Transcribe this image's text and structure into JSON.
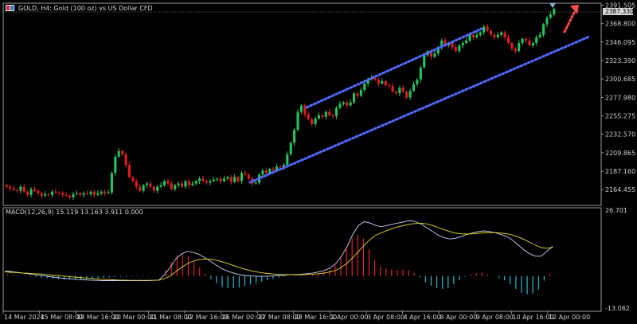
{
  "window": {
    "title": "GOLD, H4: Gold (100 oz) vs US Dollar CFD",
    "current_price_label": "2387.330"
  },
  "macd_panel": {
    "label": "MACD(12,26,9) 15.119 13.163 3.911 0.000"
  },
  "colors": {
    "background": "#000000",
    "bull": "#22c55e",
    "bear": "#e11d1d",
    "channel": "#4f6bff",
    "arrow": "#ff4d4d",
    "histogram_pos": "#e02424",
    "histogram_neg": "#22b8cf",
    "macd_line": "#c7d0ff",
    "signal_line": "#e8d92c",
    "axis_text": "#cfcfcf"
  },
  "chart_data": [
    {
      "type": "candlestick",
      "title": "GOLD, H4: Gold (100 oz) vs US Dollar CFD",
      "ylim": [
        2148,
        2392
      ],
      "y_ticks": [
        "2164.455",
        "2187.160",
        "2209.865",
        "2232.570",
        "2255.275",
        "2277.980",
        "2300.685",
        "2323.390",
        "2346.095",
        "2368.800",
        "2391.505"
      ],
      "x_ticks": [
        "14 Mar 2024",
        "15 Mar 08:00",
        "18 Mar 16:00",
        "20 Mar 00:00",
        "21 Mar 08:00",
        "22 Mar 16:00",
        "26 Mar 00:00",
        "27 Mar 08:00",
        "28 Mar 16:00",
        "2 Apr 00:00",
        "3 Apr 08:00",
        "4 Apr 16:00",
        "8 Apr 00:00",
        "9 Apr 08:00",
        "10 Apr 16:00",
        "12 Apr 00:00"
      ],
      "closes": [
        2168,
        2166,
        2164,
        2163,
        2168,
        2162,
        2158,
        2165,
        2163,
        2160,
        2157,
        2159,
        2158,
        2162,
        2161,
        2160,
        2158,
        2157,
        2155,
        2159,
        2160,
        2158,
        2160,
        2159,
        2162,
        2158,
        2160,
        2162,
        2160,
        2161,
        2185,
        2205,
        2212,
        2208,
        2195,
        2180,
        2175,
        2168,
        2163,
        2170,
        2172,
        2168,
        2163,
        2168,
        2170,
        2175,
        2172,
        2165,
        2170,
        2172,
        2168,
        2175,
        2170,
        2172,
        2175,
        2178,
        2175,
        2173,
        2175,
        2177,
        2178,
        2175,
        2178,
        2180,
        2174,
        2180,
        2175,
        2185,
        2183,
        2178,
        2172,
        2173,
        2183,
        2188,
        2185,
        2190,
        2188,
        2193,
        2192,
        2195,
        2208,
        2222,
        2238,
        2260,
        2268,
        2257,
        2251,
        2245,
        2252,
        2256,
        2254,
        2260,
        2256,
        2255,
        2265,
        2270,
        2272,
        2268,
        2272,
        2283,
        2280,
        2287,
        2295,
        2300,
        2302,
        2300,
        2295,
        2298,
        2293,
        2292,
        2285,
        2283,
        2290,
        2285,
        2278,
        2286,
        2294,
        2300,
        2315,
        2330,
        2335,
        2328,
        2332,
        2340,
        2348,
        2342,
        2345,
        2340,
        2335,
        2342,
        2345,
        2348,
        2355,
        2352,
        2355,
        2358,
        2365,
        2360,
        2355,
        2352,
        2355,
        2358,
        2352,
        2345,
        2338,
        2335,
        2345,
        2350,
        2348,
        2342,
        2345,
        2352,
        2355,
        2368,
        2376,
        2380,
        2387
      ]
    },
    {
      "type": "line+bar",
      "title": "MACD(12,26,9) 15.119 13.163 3.911 0.000",
      "ylim": [
        -13.062,
        26.701
      ],
      "y_ticks": [
        "26.701",
        "-13.062"
      ],
      "series": [
        {
          "name": "MACD",
          "values": [
            2.0,
            1.8,
            1.5,
            1.2,
            0.9,
            0.6,
            0.3,
            0.0,
            -0.3,
            -0.6,
            -0.9,
            -1.1,
            -1.3,
            -1.5,
            -1.6,
            -1.7,
            -1.8,
            -1.9,
            -1.9,
            -1.9,
            -1.9,
            -1.9,
            -1.9,
            -1.9,
            -1.9,
            -1.9,
            -1.8,
            -1.7,
            0.5,
            3.5,
            7.0,
            9.0,
            10.0,
            9.6,
            8.8,
            7.5,
            6.0,
            4.5,
            3.0,
            2.0,
            1.2,
            0.6,
            0.2,
            0.0,
            -0.1,
            -0.2,
            -0.1,
            0.0,
            0.2,
            0.3,
            0.5,
            0.6,
            0.7,
            0.9,
            1.2,
            1.6,
            2.2,
            3.2,
            5.0,
            8.0,
            12.0,
            17.0,
            20.5,
            22.0,
            21.5,
            20.5,
            20.0,
            20.5,
            21.0,
            21.5,
            22.0,
            22.5,
            22.0,
            21.0,
            19.5,
            18.0,
            16.5,
            15.5,
            15.0,
            15.3,
            16.0,
            16.8,
            17.5,
            18.0,
            18.3,
            18.0,
            17.5,
            16.8,
            16.0,
            14.5,
            12.5,
            10.5,
            9.0,
            8.0,
            8.0,
            10.0,
            12.0
          ]
        },
        {
          "name": "Signal",
          "values": [
            1.6,
            1.5,
            1.4,
            1.2,
            1.1,
            0.9,
            0.8,
            0.6,
            0.4,
            0.2,
            0.0,
            -0.2,
            -0.4,
            -0.6,
            -0.8,
            -1.0,
            -1.2,
            -1.4,
            -1.5,
            -1.6,
            -1.7,
            -1.7,
            -1.8,
            -1.8,
            -1.8,
            -1.8,
            -1.8,
            -1.7,
            -1.1,
            0.0,
            1.8,
            3.5,
            5.0,
            6.0,
            6.6,
            6.9,
            6.8,
            6.4,
            5.8,
            5.1,
            4.3,
            3.5,
            2.8,
            2.2,
            1.7,
            1.3,
            1.0,
            0.8,
            0.6,
            0.5,
            0.5,
            0.5,
            0.5,
            0.6,
            0.7,
            0.9,
            1.2,
            1.6,
            2.3,
            3.5,
            5.2,
            7.5,
            10.0,
            12.5,
            14.8,
            16.5,
            17.5,
            18.5,
            19.3,
            20.0,
            20.5,
            21.0,
            21.3,
            21.4,
            21.1,
            20.5,
            19.6,
            18.8,
            18.0,
            17.4,
            17.1,
            17.0,
            17.1,
            17.3,
            17.5,
            17.6,
            17.6,
            17.4,
            17.1,
            16.6,
            15.8,
            14.8,
            13.6,
            12.5,
            11.5,
            11.2,
            11.5
          ]
        }
      ],
      "histogram": [
        0.4,
        0.3,
        0.1,
        0.0,
        -0.2,
        -0.3,
        -0.5,
        -0.6,
        -0.7,
        -0.8,
        -0.9,
        -0.9,
        -0.9,
        -0.9,
        -0.8,
        -0.7,
        -0.6,
        -0.5,
        -0.4,
        -0.3,
        -0.2,
        -0.2,
        -0.1,
        -0.1,
        -0.1,
        -0.1,
        0.0,
        0.0,
        1.6,
        3.5,
        5.2,
        5.5,
        5.0,
        3.6,
        2.2,
        0.6,
        -0.8,
        -1.9,
        -2.8,
        -3.1,
        -3.1,
        -2.9,
        -2.6,
        -2.2,
        -1.8,
        -1.5,
        -1.1,
        -0.8,
        -0.4,
        -0.2,
        0.0,
        0.1,
        0.2,
        0.3,
        0.5,
        0.7,
        1.0,
        1.6,
        2.7,
        4.5,
        6.8,
        9.5,
        10.5,
        9.5,
        6.7,
        4.0,
        2.5,
        2.0,
        1.7,
        1.5,
        1.5,
        1.5,
        0.7,
        -0.4,
        -1.6,
        -2.5,
        -3.1,
        -3.3,
        -3.0,
        -2.1,
        -1.1,
        -0.2,
        0.4,
        0.7,
        0.8,
        0.4,
        -0.1,
        -0.6,
        -1.1,
        -2.1,
        -3.3,
        -4.3,
        -4.6,
        -4.5,
        -3.5,
        -1.2,
        0.5
      ]
    }
  ]
}
